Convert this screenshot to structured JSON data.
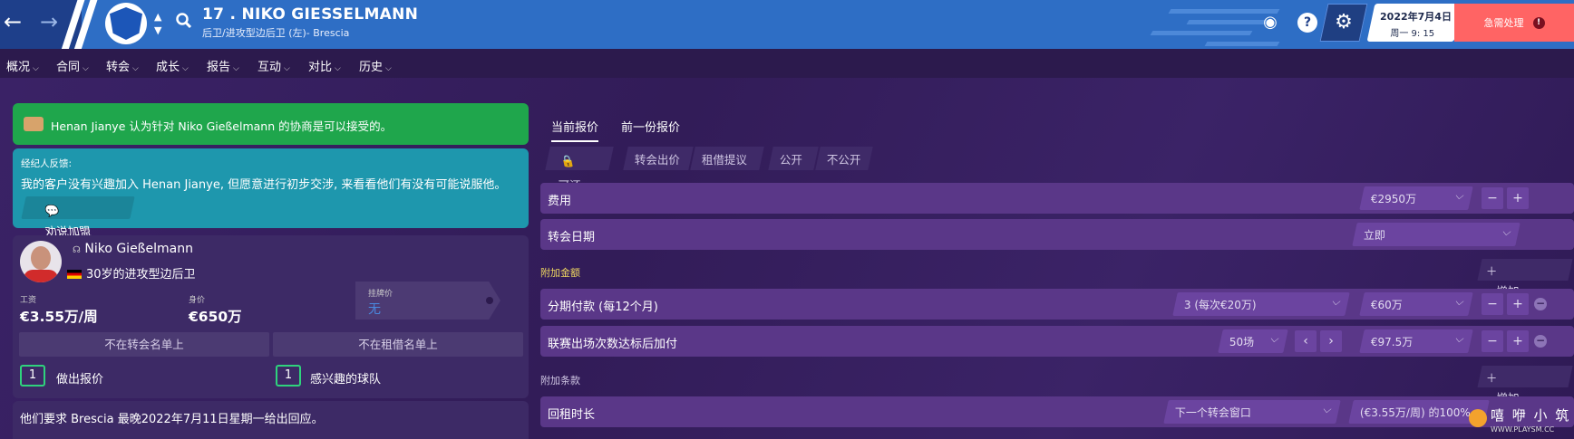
{
  "header": {
    "player_title": "17 . NIKO GIESSELMANN",
    "player_subtitle": "后卫/进攻型边后卫 (左)- Brescia",
    "date": "2022年7月4日",
    "time": "周一 9: 15",
    "urgent_label": "急需处理",
    "urgent_badge": "!",
    "help": "?"
  },
  "menu": [
    {
      "label": "概况"
    },
    {
      "label": "合同"
    },
    {
      "label": "转会"
    },
    {
      "label": "成长"
    },
    {
      "label": "报告"
    },
    {
      "label": "互动"
    },
    {
      "label": "对比"
    },
    {
      "label": "历史"
    }
  ],
  "notification_count": "1",
  "left": {
    "green_msg": "Henan Jianye 认为针对 Niko Gießelmann 的协商是可以接受的。",
    "agent_title": "经纪人反馈:",
    "agent_msg": "我的客户没有兴趣加入 Henan Jianye, 但愿意进行初步交涉, 来看看他们有没有可能说服他。",
    "persuade_btn": "劝说加盟",
    "player_name": "Niko Gießelmann",
    "player_desc": "30岁的进攻型边后卫",
    "wage_label": "工资",
    "wage_value": "€3.55万/周",
    "value_label": "身价",
    "value_value": "€650万",
    "asking_label": "挂牌价",
    "asking_value": "无",
    "not_transfer_listed": "不在转会名单上",
    "not_loan_listed": "不在租借名单上",
    "offers_count": "1",
    "offers_label": "做出报价",
    "interested_count": "1",
    "interested_label": "感兴趣的球队",
    "reply_msg": "他们要求 Brescia 最晚2022年7月11日星期一给出回应。"
  },
  "right": {
    "tabs": [
      "当前报价",
      "前一份报价"
    ],
    "negotiable": "可还价",
    "transfer_offer": "转会出价",
    "loan_offer": "租借提议",
    "public": "公开",
    "private": "不公开",
    "fee_label": "费用",
    "fee_value": "€2950万",
    "transfer_date_label": "转会日期",
    "transfer_date_value": "立即",
    "add_ons_title": "附加金额",
    "add_label": "增加",
    "installments_label": "分期付款 (每12个月)",
    "installments_value": "3 (每次€20万)",
    "installments_amount": "€60万",
    "appearances_label": "联赛出场次数达标后加付",
    "appearances_value": "50场",
    "appearances_amount": "€97.5万",
    "clauses_title": "附加条款",
    "loan_back_label": "回租时长",
    "loan_back_value": "下一个转会窗口",
    "loan_back_wage": "(€3.55万/周) 的100%"
  },
  "watermark": {
    "line1": "嘻 咿 小 筑",
    "line2": "WWW.PLAYSM.CC"
  },
  "colors": {
    "top_bar": "#2e6ec5",
    "bg": "#2c1a4d",
    "green": "#1fa64c",
    "teal": "#1e97ad",
    "row": "#5a3788",
    "urgent": "#ff6464",
    "count_border": "#2fd37d"
  }
}
